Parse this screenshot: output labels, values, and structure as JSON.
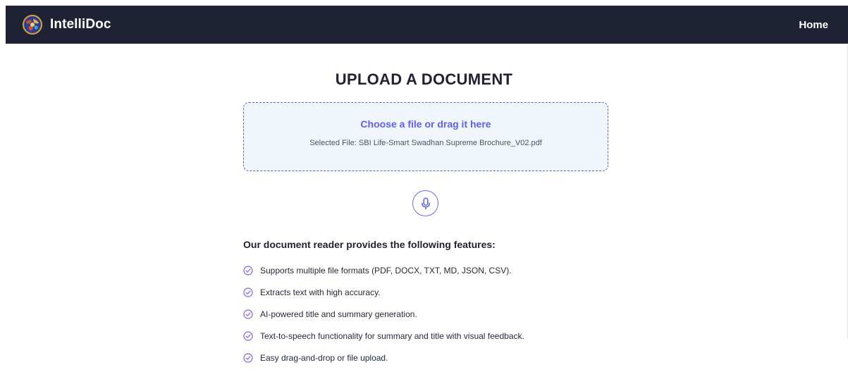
{
  "nav": {
    "brand": "IntelliDoc",
    "logo_icon": "globe-logo-icon",
    "home_label": "Home"
  },
  "main": {
    "title": "UPLOAD A DOCUMENT",
    "dropzone": {
      "label": "Choose a file or drag it here",
      "selected_file": "Selected File: SBI Life-Smart Swadhan Supreme Brochure_V02.pdf"
    },
    "mic_icon": "microphone-icon",
    "features_heading": "Our document reader provides the following features:",
    "features": [
      "Supports multiple file formats (PDF, DOCX, TXT, MD, JSON, CSV).",
      "Extracts text with high accuracy.",
      "AI-powered title and summary generation.",
      "Text-to-speech functionality for summary and title with visual feedback.",
      "Easy drag-and-drop or file upload."
    ]
  },
  "colors": {
    "navbar_bg": "#1e2234",
    "accent": "#5b5ff0",
    "dropzone_bg": "#f1f6fc",
    "dropzone_border": "#5b63d6",
    "check": "#6d6af5"
  }
}
